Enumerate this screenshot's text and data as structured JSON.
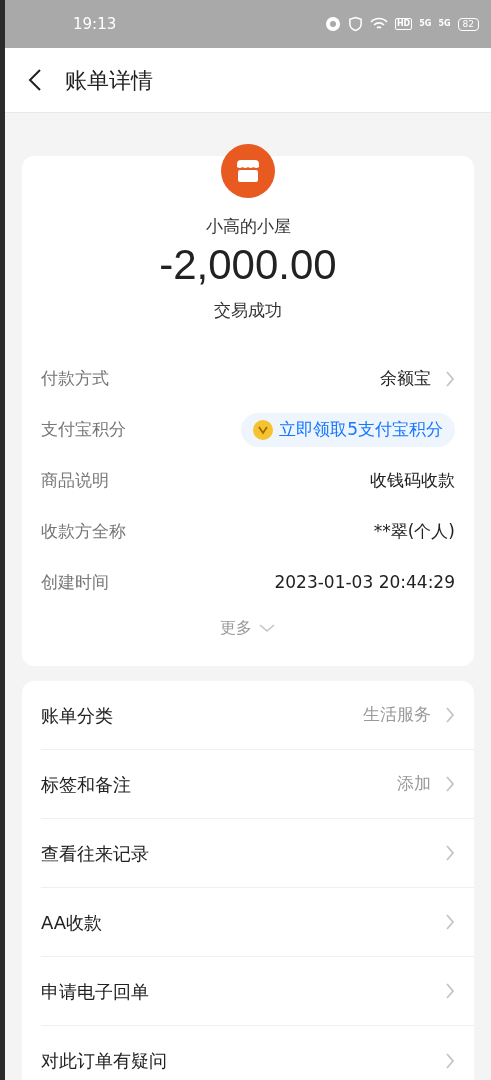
{
  "status_bar": {
    "time": "19:13",
    "network_labels": [
      "HD",
      "5G",
      "5G"
    ],
    "battery": "82"
  },
  "header": {
    "title": "账单详情"
  },
  "summary": {
    "merchant": "小高的小屋",
    "amount": "-2,000.00",
    "status": "交易成功"
  },
  "details": [
    {
      "kind": "text",
      "label": "付款方式",
      "value": "余额宝",
      "chevron": true
    },
    {
      "kind": "promo",
      "label": "支付宝积分",
      "value": "立即领取5支付宝积分",
      "chevron": false
    },
    {
      "kind": "text",
      "label": "商品说明",
      "value": "收钱码收款",
      "chevron": false
    },
    {
      "kind": "text",
      "label": "收款方全称",
      "value": "**翠(个人)",
      "chevron": false
    },
    {
      "kind": "text",
      "label": "创建时间",
      "value": "2023-01-03 20:44:29",
      "chevron": false
    }
  ],
  "more": "更多",
  "actions": [
    {
      "label": "账单分类",
      "value": "生活服务"
    },
    {
      "label": "标签和备注",
      "value": "添加"
    },
    {
      "label": "查看往来记录"
    },
    {
      "label": "AA收款"
    },
    {
      "label": "申请电子回单"
    },
    {
      "label": "对此订单有疑问"
    }
  ]
}
